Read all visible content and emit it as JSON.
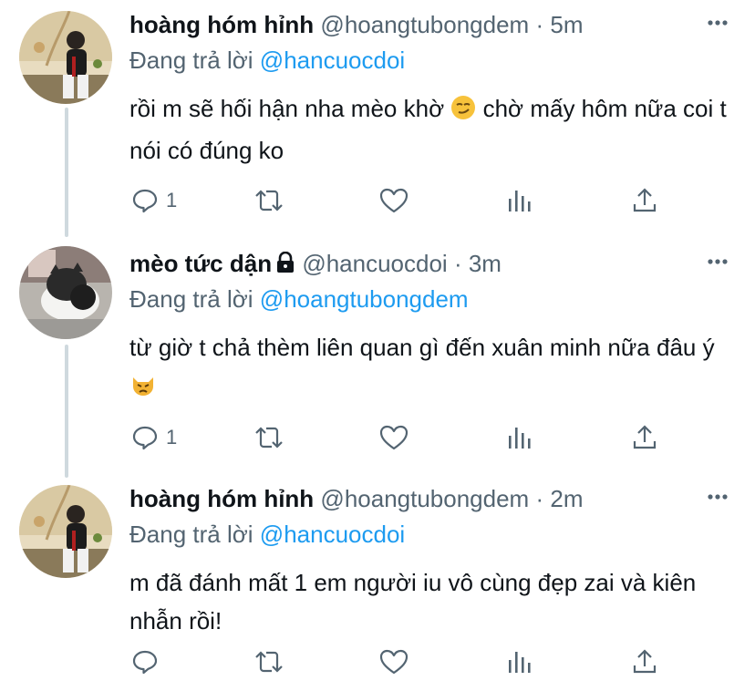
{
  "colors": {
    "text": "#0f1419",
    "muted": "#536471",
    "link": "#1d9bf0",
    "thread_line": "#cfd9de"
  },
  "tweets": [
    {
      "display_name": "hoàng hóm hỉnh",
      "handle": "@hoangtubongdem",
      "separator": "·",
      "time": "5m",
      "reply_prefix": "Đang trả lời",
      "reply_to": "@hancuocdoi",
      "text": "rồi m sẽ hối hận nha mèo khờ",
      "text_emoji": "smirk-emoji",
      "text_after_emoji": "chờ mấy hôm nữa coi t nói có đúng ko",
      "reply_count": "1",
      "avatar": "avatar-photo-person-sitting",
      "locked": false
    },
    {
      "display_name": "mèo tức dận",
      "handle": "@hancuocdoi",
      "separator": "·",
      "time": "3m",
      "reply_prefix": "Đang trả lời",
      "reply_to": "@hoangtubongdem",
      "text": "từ giờ t chả thèm liên quan gì đến xuân minh nữa đâu ý",
      "text_emoji": "pouting-cat-emoji",
      "text_after_emoji": "",
      "reply_count": "1",
      "avatar": "avatar-photo-cat",
      "locked": true
    },
    {
      "display_name": "hoàng hóm hỉnh",
      "handle": "@hoangtubongdem",
      "separator": "·",
      "time": "2m",
      "reply_prefix": "Đang trả lời",
      "reply_to": "@hancuocdoi",
      "text": "m đã đánh mất 1 em người iu vô cùng đẹp zai và kiên nhẫn rồi!",
      "text_emoji": "",
      "text_after_emoji": "",
      "reply_count": "",
      "avatar": "avatar-photo-person-sitting",
      "locked": false
    }
  ],
  "icons": {
    "reply": "reply-bubble-icon",
    "retweet": "retweet-icon",
    "like": "heart-icon",
    "analytics": "analytics-bars-icon",
    "share": "share-upload-icon",
    "more": "more-dots-icon",
    "lock": "lock-icon"
  }
}
